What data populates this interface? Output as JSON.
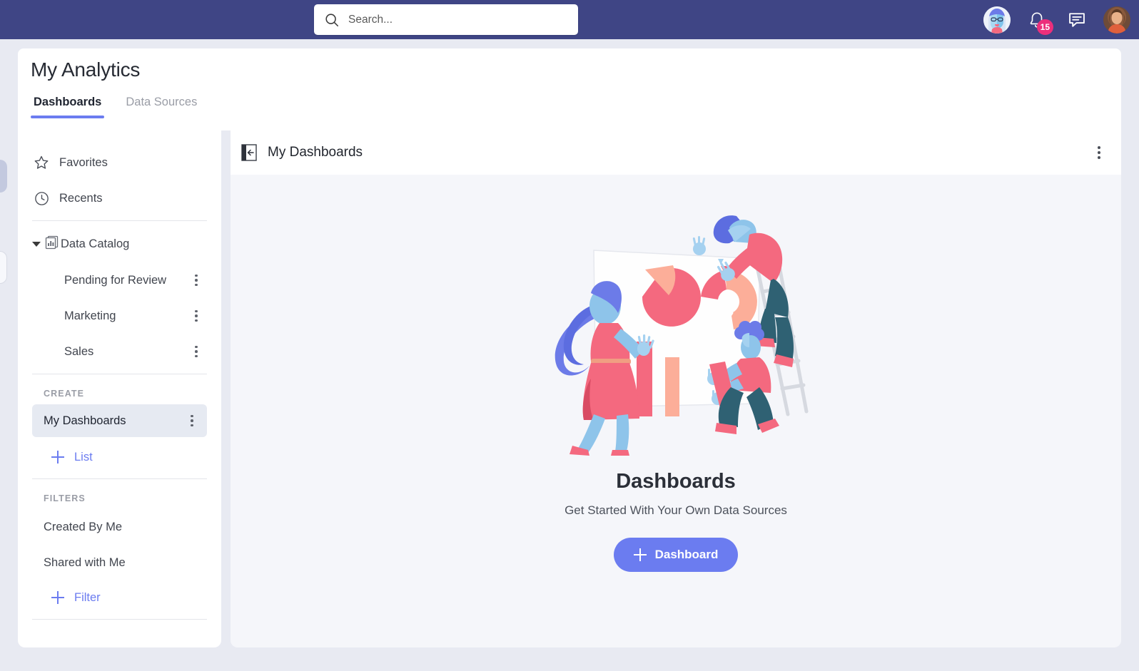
{
  "topnav": {
    "background": "#3F4585",
    "search": {
      "placeholder": "Search...",
      "value": "",
      "icon": "search-icon"
    },
    "items": [
      {
        "icon": "user-avatar-illustration",
        "name": "profile-avatar-illustration"
      },
      {
        "icon": "bell-icon",
        "name": "notifications",
        "badge": "15",
        "badge_color": "#EC2F7B"
      },
      {
        "icon": "chat-bubble-icon",
        "name": "messages"
      },
      {
        "icon": "user-avatar-photo",
        "name": "account-avatar"
      }
    ]
  },
  "header": {
    "title": "My Analytics",
    "tabs": [
      {
        "label": "Dashboards",
        "active": true
      },
      {
        "label": "Data Sources",
        "active": false
      }
    ],
    "active_color": "#6B7CF0"
  },
  "sidebar": {
    "quick": [
      {
        "label": "Favorites",
        "icon": "star-icon"
      },
      {
        "label": "Recents",
        "icon": "clock-icon"
      }
    ],
    "catalog": {
      "label": "Data Catalog",
      "icon": "data-catalog-icon",
      "expanded": true,
      "items": [
        {
          "label": "Pending for Review",
          "menu": "kebab-icon"
        },
        {
          "label": "Marketing",
          "menu": "kebab-icon"
        },
        {
          "label": "Sales",
          "menu": "kebab-icon"
        }
      ]
    },
    "create": {
      "section_label": "CREATE",
      "selected": {
        "label": "My Dashboards",
        "menu": "kebab-icon"
      },
      "add": {
        "label": "List",
        "icon": "plus-icon"
      }
    },
    "filters": {
      "section_label": "FILTERS",
      "items": [
        {
          "label": "Created By Me"
        },
        {
          "label": "Shared with Me"
        }
      ],
      "add": {
        "label": "Filter",
        "icon": "plus-icon"
      }
    }
  },
  "panel": {
    "collapse_icon": "collapse-panel-icon",
    "title": "My Dashboards",
    "menu": "kebab-icon",
    "empty_state": {
      "illustration": "dashboards-teamwork-illustration",
      "title": "Dashboards",
      "subtitle": "Get Started With Your Own Data Sources",
      "cta_label": "Dashboard",
      "cta_icon": "plus-icon",
      "cta_color": "#6B7CF0"
    }
  },
  "edge_tabs": [
    {
      "name": "edge-tab-filled"
    },
    {
      "name": "edge-tab-outline"
    }
  ]
}
